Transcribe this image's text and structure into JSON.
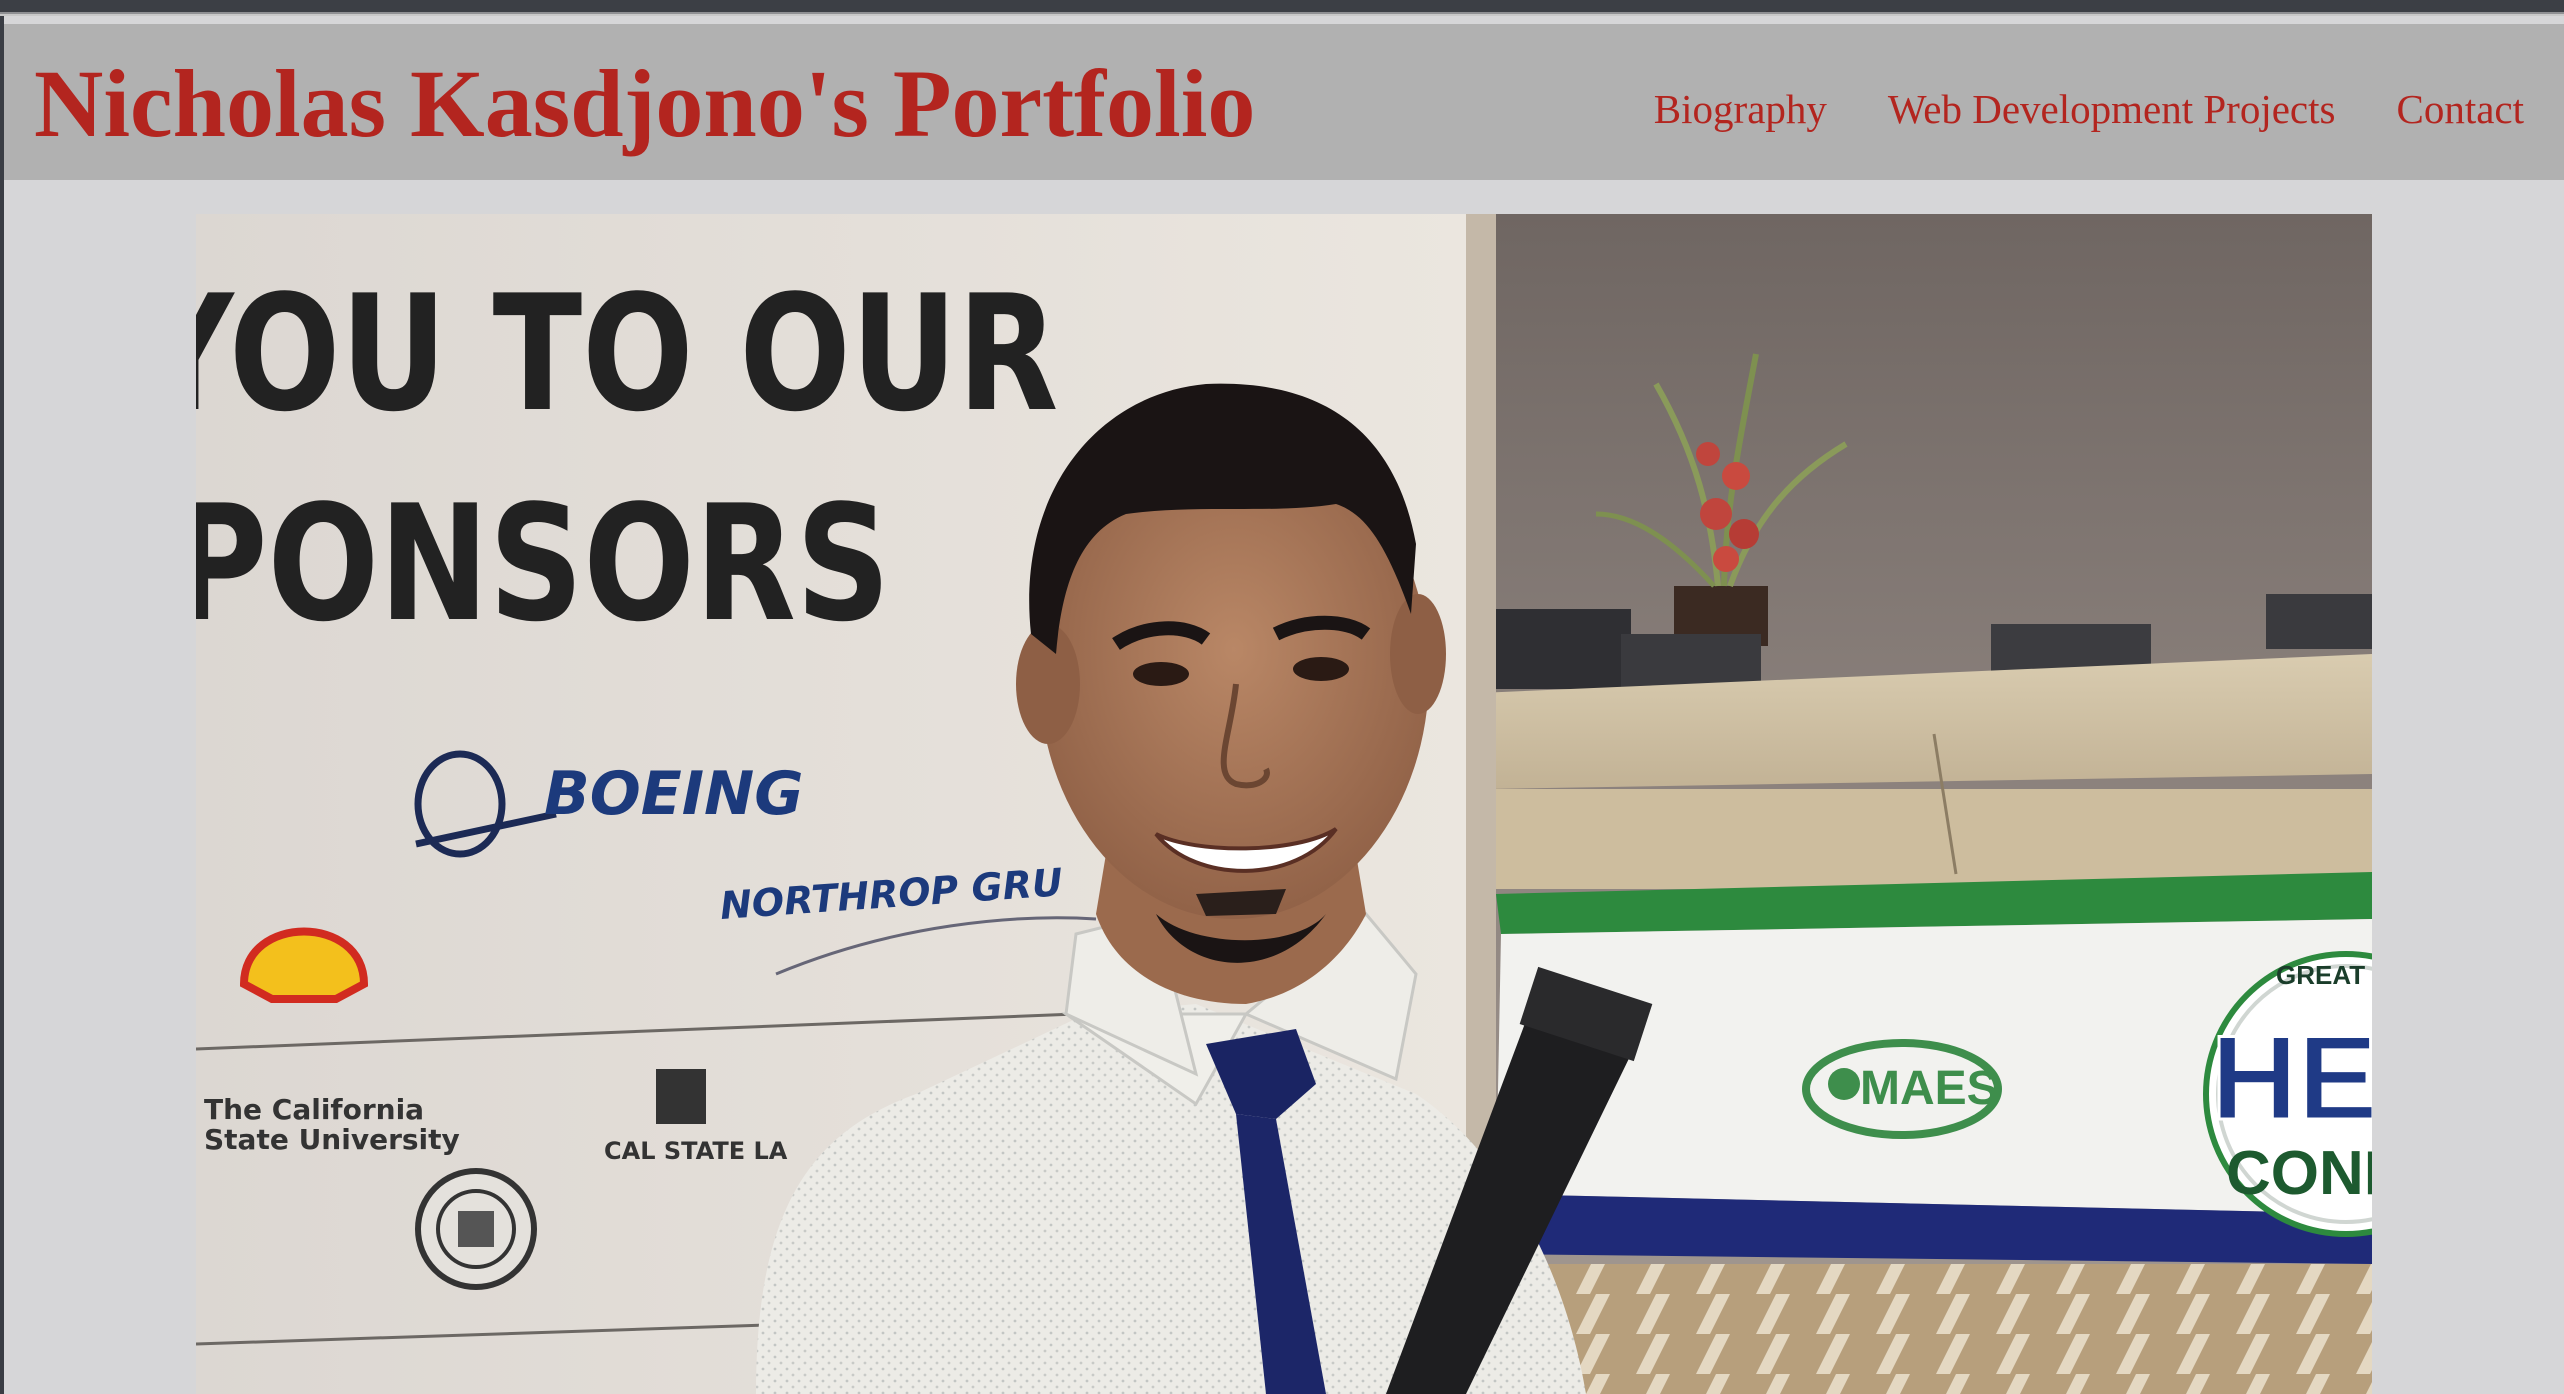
{
  "header": {
    "title": "Nicholas Kasdjono's Portfolio",
    "nav": [
      {
        "label": "Biography"
      },
      {
        "label": "Web Development Projects"
      },
      {
        "label": "Contact"
      }
    ]
  },
  "hero": {
    "banner": {
      "line1": "YOU TO OUR",
      "line2": "PONSORS",
      "sponsors": [
        "BOEING",
        "NORTHROP GRU"
      ],
      "csu_line1": "The California",
      "csu_line2": "State University",
      "calstate": "CAL STATE LA"
    },
    "booth": {
      "maes": "MAES",
      "hena": "HENA",
      "confer": "CONFERE",
      "great": "GREAT"
    }
  },
  "colors": {
    "accent": "#b3251f",
    "header_bg": "#b1b1b1",
    "page_bg": "#d6d6d8"
  }
}
